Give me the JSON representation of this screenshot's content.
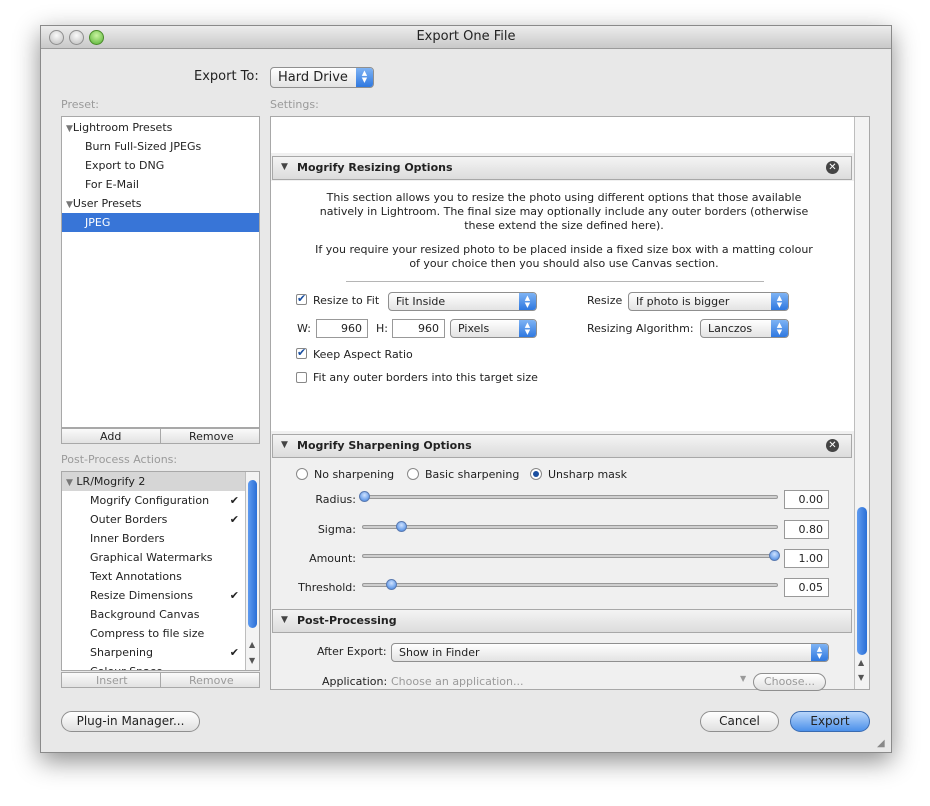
{
  "window": {
    "title": "Export One File"
  },
  "export_to": {
    "label": "Export To:",
    "value": "Hard Drive"
  },
  "preset": {
    "label": "Preset:",
    "groups": [
      {
        "name": "Lightroom Presets",
        "items": [
          "Burn Full-Sized JPEGs",
          "Export to DNG",
          "For E-Mail"
        ]
      },
      {
        "name": "User Presets",
        "items": [
          "JPEG"
        ]
      }
    ],
    "selected": "JPEG",
    "add_label": "Add",
    "remove_label": "Remove"
  },
  "post_process_actions": {
    "label": "Post-Process Actions:",
    "plugin": "LR/Mogrify 2",
    "items": [
      {
        "label": "Mogrify Configuration",
        "checked": true
      },
      {
        "label": "Outer Borders",
        "checked": true
      },
      {
        "label": "Inner Borders",
        "checked": false
      },
      {
        "label": "Graphical Watermarks",
        "checked": false
      },
      {
        "label": "Text Annotations",
        "checked": false
      },
      {
        "label": "Resize Dimensions",
        "checked": true
      },
      {
        "label": "Background Canvas",
        "checked": false
      },
      {
        "label": "Compress to file size",
        "checked": false
      },
      {
        "label": "Sharpening",
        "checked": true
      },
      {
        "label": "Colour Space",
        "checked": false
      }
    ],
    "checkmark": "✔",
    "insert_label": "Insert",
    "remove_label": "Remove"
  },
  "settings": {
    "label": "Settings:"
  },
  "resizing": {
    "title": "Mogrify Resizing Options",
    "desc1_lines": [
      "This section allows you to resize the photo using different options that those available",
      "natively in Lightroom. The final size may optionally include any outer borders (otherwise",
      "these extend the size defined here)."
    ],
    "desc2_lines": [
      "If you require your resized photo to be placed inside a fixed size box with a matting colour",
      "of your choice then you should also use Canvas section."
    ],
    "resize_to_fit_label": "Resize to Fit",
    "resize_to_fit_checked": true,
    "fit_mode": "Fit Inside",
    "resize_label": "Resize",
    "resize_value": "If photo is bigger",
    "w_label": "W:",
    "w_value": "960",
    "h_label": "H:",
    "h_value": "960",
    "units": "Pixels",
    "algorithm_label": "Resizing Algorithm:",
    "algorithm_value": "Lanczos",
    "keep_aspect_label": "Keep Aspect Ratio",
    "keep_aspect_checked": true,
    "fit_borders_label": "Fit any outer borders into this target size",
    "fit_borders_checked": false
  },
  "sharpening": {
    "title": "Mogrify Sharpening Options",
    "modes": [
      "No sharpening",
      "Basic sharpening",
      "Unsharp mask"
    ],
    "selected_mode": "Unsharp mask",
    "sliders": [
      {
        "label": "Radius:",
        "value": "0.00",
        "position": 0.0
      },
      {
        "label": "Sigma:",
        "value": "0.80",
        "position": 0.09
      },
      {
        "label": "Amount:",
        "value": "1.00",
        "position": 1.0
      },
      {
        "label": "Threshold:",
        "value": "0.05",
        "position": 0.065
      }
    ]
  },
  "post_processing": {
    "title": "Post-Processing",
    "after_export_label": "After Export:",
    "after_export_value": "Show in Finder",
    "application_label": "Application:",
    "application_placeholder": "Choose an application...",
    "choose_label": "Choose..."
  },
  "footer": {
    "plugin_manager_label": "Plug-in Manager...",
    "cancel_label": "Cancel",
    "export_label": "Export"
  },
  "colors": {
    "accent": "#3875d7",
    "window_bg": "#e8e8e8"
  },
  "icons": {
    "close": "close-x-icon",
    "disclosure": "disclosure-triangle-icon",
    "checkmark": "checkmark-icon"
  }
}
